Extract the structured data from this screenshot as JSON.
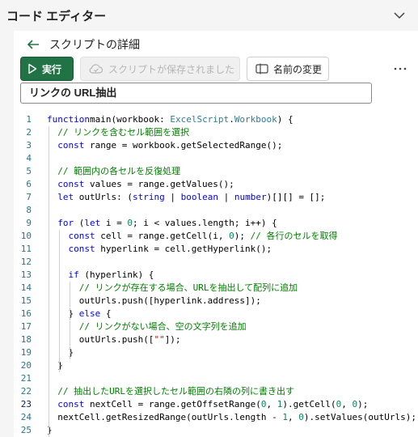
{
  "pane": {
    "title": "コード エディター"
  },
  "details": {
    "title": "スクリプトの詳細"
  },
  "toolbar": {
    "run_label": "実行",
    "save_label": "スクリプトが保存されました",
    "rename_label": "名前の変更"
  },
  "script_name": "リンクの URL抽出",
  "editor": {
    "active_line": 23,
    "lines": [
      {
        "n": "1",
        "indent": 0,
        "tokens": [
          [
            "kw",
            "function"
          ],
          [
            "",
            "main(workbook: "
          ],
          [
            "ty",
            "ExcelScript"
          ],
          [
            "",
            "."
          ],
          [
            "ty",
            "Workbook"
          ],
          [
            "",
            ") {"
          ]
        ]
      },
      {
        "n": "2",
        "indent": 2,
        "tokens": [
          [
            "cm",
            "// リンクを含むセル範囲を選択"
          ]
        ]
      },
      {
        "n": "3",
        "indent": 2,
        "tokens": [
          [
            "kw",
            "const"
          ],
          [
            "",
            " range = workbook.getSelectedRange();"
          ]
        ]
      },
      {
        "n": "4",
        "indent": 0,
        "tokens": []
      },
      {
        "n": "5",
        "indent": 2,
        "tokens": [
          [
            "cm",
            "// 範囲内の各セルを反復処理"
          ]
        ]
      },
      {
        "n": "6",
        "indent": 2,
        "tokens": [
          [
            "kw",
            "const"
          ],
          [
            "",
            " values = range.getValues();"
          ]
        ]
      },
      {
        "n": "7",
        "indent": 2,
        "tokens": [
          [
            "kw",
            "let"
          ],
          [
            "",
            " outUrls: ("
          ],
          [
            "kw",
            "string"
          ],
          [
            "",
            " | "
          ],
          [
            "kw",
            "boolean"
          ],
          [
            "",
            " | "
          ],
          [
            "kw",
            "number"
          ],
          [
            "",
            ")[][] = [];"
          ]
        ]
      },
      {
        "n": "8",
        "indent": 0,
        "tokens": []
      },
      {
        "n": "9",
        "indent": 2,
        "tokens": [
          [
            "kw",
            "for"
          ],
          [
            "",
            " ("
          ],
          [
            "kw",
            "let"
          ],
          [
            "",
            " i = "
          ],
          [
            "nm",
            "0"
          ],
          [
            "",
            "; i < values.length; i++) {"
          ]
        ]
      },
      {
        "n": "10",
        "indent": 4,
        "tokens": [
          [
            "kw",
            "const"
          ],
          [
            "",
            " cell = range.getCell(i, "
          ],
          [
            "nm",
            "0"
          ],
          [
            "",
            "); "
          ],
          [
            "cm",
            "// 各行のセルを取得"
          ]
        ]
      },
      {
        "n": "11",
        "indent": 4,
        "tokens": [
          [
            "kw",
            "const"
          ],
          [
            "",
            " hyperlink = cell.getHyperlink();"
          ]
        ]
      },
      {
        "n": "12",
        "indent": 0,
        "tokens": []
      },
      {
        "n": "13",
        "indent": 4,
        "tokens": [
          [
            "kw",
            "if"
          ],
          [
            "",
            " (hyperlink) {"
          ]
        ]
      },
      {
        "n": "14",
        "indent": 6,
        "tokens": [
          [
            "cm",
            "// リンクが存在する場合、URLを抽出して配列に追加"
          ]
        ]
      },
      {
        "n": "15",
        "indent": 6,
        "tokens": [
          [
            "",
            "outUrls.push([hyperlink.address]);"
          ]
        ]
      },
      {
        "n": "16",
        "indent": 4,
        "tokens": [
          [
            "",
            "} "
          ],
          [
            "kw",
            "else"
          ],
          [
            "",
            " {"
          ]
        ]
      },
      {
        "n": "17",
        "indent": 6,
        "tokens": [
          [
            "cm",
            "// リンクがない場合、空の文字列を追加"
          ]
        ]
      },
      {
        "n": "18",
        "indent": 6,
        "tokens": [
          [
            "",
            "outUrls.push(["
          ],
          [
            "st",
            "\"\""
          ],
          [
            "",
            "]);"
          ]
        ]
      },
      {
        "n": "19",
        "indent": 4,
        "tokens": [
          [
            "",
            "}"
          ]
        ]
      },
      {
        "n": "20",
        "indent": 2,
        "tokens": [
          [
            "",
            "}"
          ]
        ]
      },
      {
        "n": "21",
        "indent": 0,
        "tokens": []
      },
      {
        "n": "22",
        "indent": 2,
        "tokens": [
          [
            "cm",
            "// 抽出したURLを選択したセル範囲の右隣の列に書き出す"
          ]
        ]
      },
      {
        "n": "23",
        "indent": 2,
        "tokens": [
          [
            "kw",
            "const"
          ],
          [
            "",
            " nextCell = range.getOffsetRange("
          ],
          [
            "nm",
            "0"
          ],
          [
            "",
            ", "
          ],
          [
            "nm",
            "1"
          ],
          [
            "",
            ").getCell("
          ],
          [
            "nm",
            "0"
          ],
          [
            "",
            ", "
          ],
          [
            "nm",
            "0"
          ],
          [
            "",
            ");"
          ]
        ]
      },
      {
        "n": "24",
        "indent": 2,
        "tokens": [
          [
            "",
            "nextCell.getResizedRange(outUrls.length - "
          ],
          [
            "nm",
            "1"
          ],
          [
            "",
            ", "
          ],
          [
            "nm",
            "0"
          ],
          [
            "",
            ").setValues(outUrls);"
          ]
        ]
      },
      {
        "n": "25",
        "indent": 0,
        "tokens": [
          [
            "",
            "}"
          ]
        ]
      }
    ]
  }
}
